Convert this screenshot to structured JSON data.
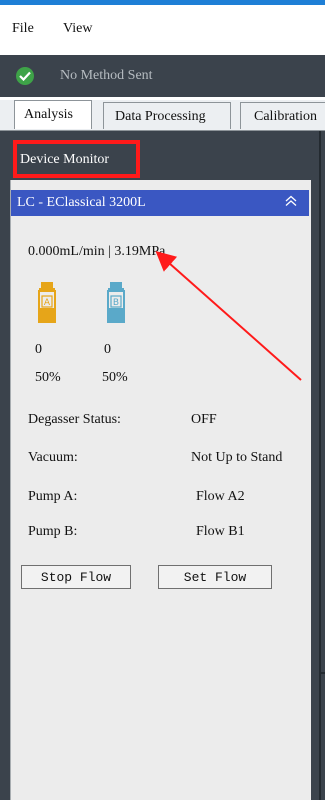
{
  "menubar": {
    "items": [
      "File",
      "View"
    ]
  },
  "status": {
    "text": "No Method Sent",
    "icon": "check-circle-icon",
    "color": "#3ea348"
  },
  "tabs": [
    {
      "label": "Analysis",
      "active": true
    },
    {
      "label": "Data Processing",
      "active": false
    },
    {
      "label": "Calibration",
      "active": false
    }
  ],
  "monitor": {
    "title": "Device Monitor",
    "highlight_color": "#ff1a1a",
    "device": {
      "name": "LC - EClassical 3200L",
      "collapse_icon": "double-chevron-up-icon",
      "flow_readout": "0.000mL/min | 3.19MPa",
      "bottles": [
        {
          "letter": "A",
          "value": "0",
          "percent": "50%",
          "color": "#e6a519"
        },
        {
          "letter": "B",
          "value": "0",
          "percent": "50%",
          "color": "#5aa9c9"
        }
      ],
      "rows": [
        {
          "label": "Degasser Status:",
          "value": "OFF"
        },
        {
          "label": "Vacuum:",
          "value": "Not Up to Stand"
        },
        {
          "label": "Pump A:",
          "value": "Flow A2"
        },
        {
          "label": "Pump B:",
          "value": "Flow B1"
        }
      ],
      "buttons": {
        "stop": "Stop Flow",
        "set": "Set Flow"
      }
    }
  }
}
